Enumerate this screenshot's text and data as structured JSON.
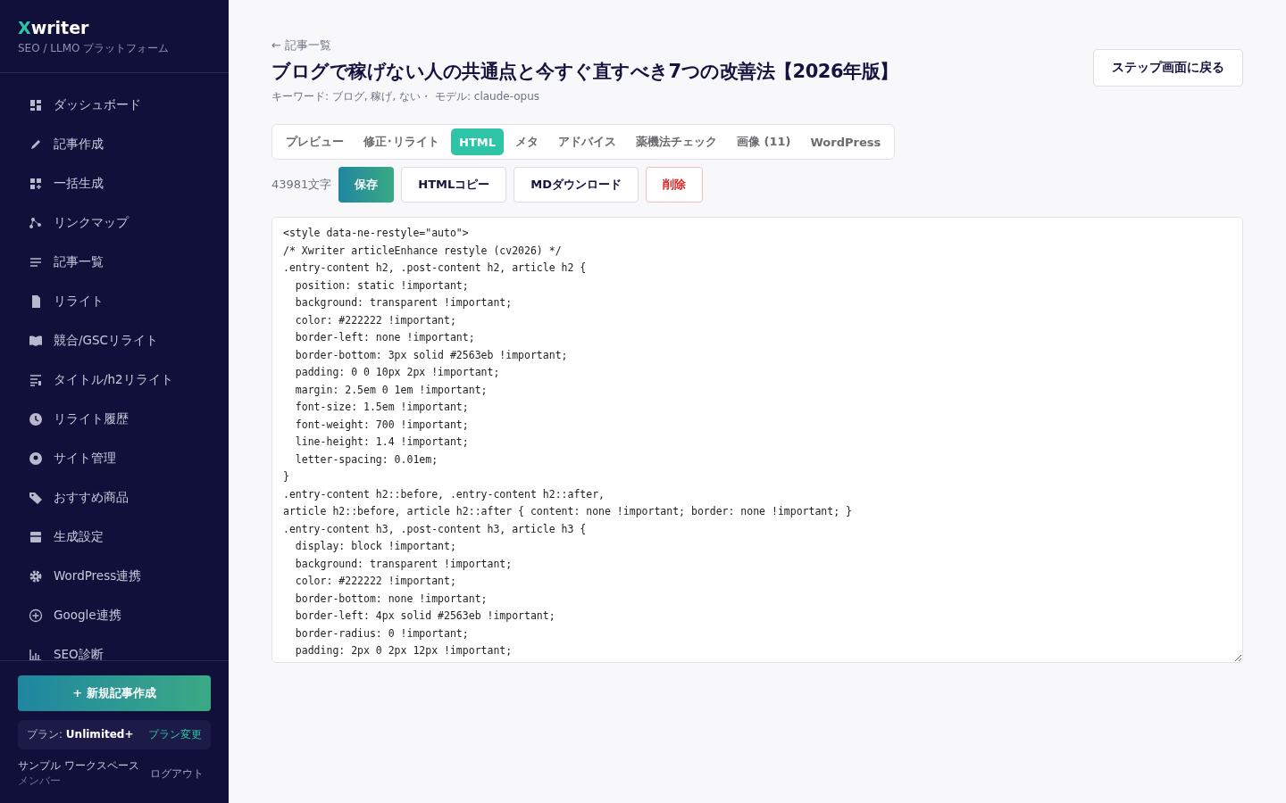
{
  "brand": {
    "initial": "X",
    "rest": "writer",
    "subtitle": "SEO / LLMO プラットフォーム"
  },
  "nav": [
    {
      "label": "ダッシュボード"
    },
    {
      "label": "記事作成"
    },
    {
      "label": "一括生成"
    },
    {
      "label": "リンクマップ"
    },
    {
      "label": "記事一覧"
    },
    {
      "label": "リライト"
    },
    {
      "label": "競合/GSCリライト"
    },
    {
      "label": "タイトル/h2リライト"
    },
    {
      "label": "リライト履歴"
    },
    {
      "label": "サイト管理"
    },
    {
      "label": "おすすめ商品"
    },
    {
      "label": "生成設定"
    },
    {
      "label": "WordPress連携"
    },
    {
      "label": "Google連携"
    },
    {
      "label": "SEO診断"
    }
  ],
  "new_button": "+ 新規記事作成",
  "plan": {
    "label": "プラン: ",
    "name": "Unlimited+",
    "change": "プラン変更"
  },
  "workspace": {
    "name": "サンプル ワークスペース",
    "role": "メンバー",
    "logout": "ログアウト"
  },
  "back_link": "← 記事一覧",
  "title": "ブログで稼げない人の共通点と今すぐ直すべき7つの改善法【2026年版】",
  "meta": "キーワード: ブログ, 稼げ, ない・ モデル: claude-opus",
  "step_button": "ステップ画面に戻る",
  "tabs": [
    {
      "label": "プレビュー",
      "selected": false
    },
    {
      "label": "修正･リライト",
      "selected": false
    },
    {
      "label": "HTML",
      "selected": true
    },
    {
      "label": "メタ",
      "selected": false
    },
    {
      "label": "アドバイス",
      "selected": false
    },
    {
      "label": "薬機法チェック",
      "selected": false
    },
    {
      "label": "画像 (11)",
      "selected": false
    },
    {
      "label": "WordPress",
      "selected": false
    }
  ],
  "char_count": "43981文字",
  "actions": [
    {
      "label": "保存",
      "kind": "primary"
    },
    {
      "label": "HTMLコピー",
      "kind": "outline"
    },
    {
      "label": "MDダウンロード",
      "kind": "outline"
    },
    {
      "label": "削除",
      "kind": "danger"
    }
  ],
  "editor_lines": [
    "<style data-ne-restyle=\"auto\">",
    "/* Xwriter articleEnhance restyle (cv2026) */",
    ".entry-content h2, .post-content h2, article h2 {",
    "  position: static !important;",
    "  background: transparent !important;",
    "  color: #222222 !important;",
    "  border-left: none !important;",
    "  border-bottom: 3px solid #2563eb !important;",
    "  padding: 0 0 10px 2px !important;",
    "  margin: 2.5em 0 1em !important;",
    "  font-size: 1.5em !important;",
    "  font-weight: 700 !important;",
    "  line-height: 1.4 !important;",
    "  letter-spacing: 0.01em;",
    "}",
    ".entry-content h2::before, .entry-content h2::after,",
    "article h2::before, article h2::after { content: none !important; border: none !important; }",
    ".entry-content h3, .post-content h3, article h3 {",
    "  display: block !important;",
    "  background: transparent !important;",
    "  color: #222222 !important;",
    "  border-bottom: none !important;",
    "  border-left: 4px solid #2563eb !important;",
    "  border-radius: 0 !important;",
    "  padding: 2px 0 2px 12px !important;"
  ]
}
